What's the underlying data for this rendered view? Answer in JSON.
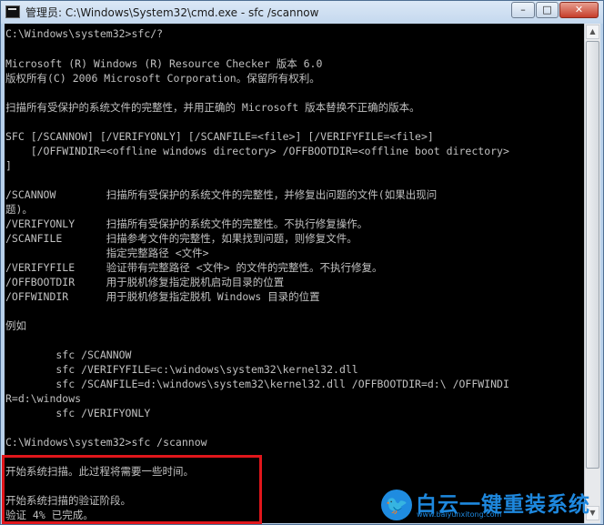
{
  "window": {
    "title": "管理员: C:\\Windows\\System32\\cmd.exe - sfc  /scannow",
    "buttons": {
      "minimize": "–",
      "maximize": "□",
      "close": "✕"
    }
  },
  "console": {
    "lines": [
      "C:\\Windows\\system32>sfc/?",
      "Microsoft (R) Windows (R) Resource Checker 版本 6.0",
      "版权所有(C) 2006 Microsoft Corporation。保留所有权利。",
      "扫描所有受保护的系统文件的完整性，并用正确的 Microsoft 版本替换不正确的版本。",
      "SFC [/SCANNOW] [/VERIFYONLY] [/SCANFILE=<file>] [/VERIFYFILE=<file>]",
      "    [/OFFWINDIR=<offline windows directory> /OFFBOOTDIR=<offline boot directory>",
      "]",
      "/SCANNOW        扫描所有受保护的系统文件的完整性，并修复出问题的文件(如果出现问",
      "题)。",
      "/VERIFYONLY     扫描所有受保护的系统文件的完整性。不执行修复操作。",
      "/SCANFILE       扫描参考文件的完整性，如果找到问题，则修复文件。",
      "                指定完整路径 <文件>",
      "/VERIFYFILE     验证带有完整路径 <文件> 的文件的完整性。不执行修复。",
      "/OFFBOOTDIR     用于脱机修复指定脱机启动目录的位置",
      "/OFFWINDIR      用于脱机修复指定脱机 Windows 目录的位置",
      "例如",
      "        sfc /SCANNOW",
      "        sfc /VERIFYFILE=c:\\windows\\system32\\kernel32.dll",
      "        sfc /SCANFILE=d:\\windows\\system32\\kernel32.dll /OFFBOOTDIR=d:\\ /OFFWINDI",
      "R=d:\\windows",
      "        sfc /VERIFYONLY",
      "C:\\Windows\\system32>sfc /scannow",
      "开始系统扫描。此过程将需要一些时间。",
      "开始系统扫描的验证阶段。",
      "验证 4% 已完成。"
    ]
  },
  "watermark": {
    "title": "白云一键重装系统",
    "url": "www.baiyunxitong.com",
    "icon": "twitter-bird-icon",
    "color": "#1e88de"
  },
  "highlight_color": "#e0161b"
}
